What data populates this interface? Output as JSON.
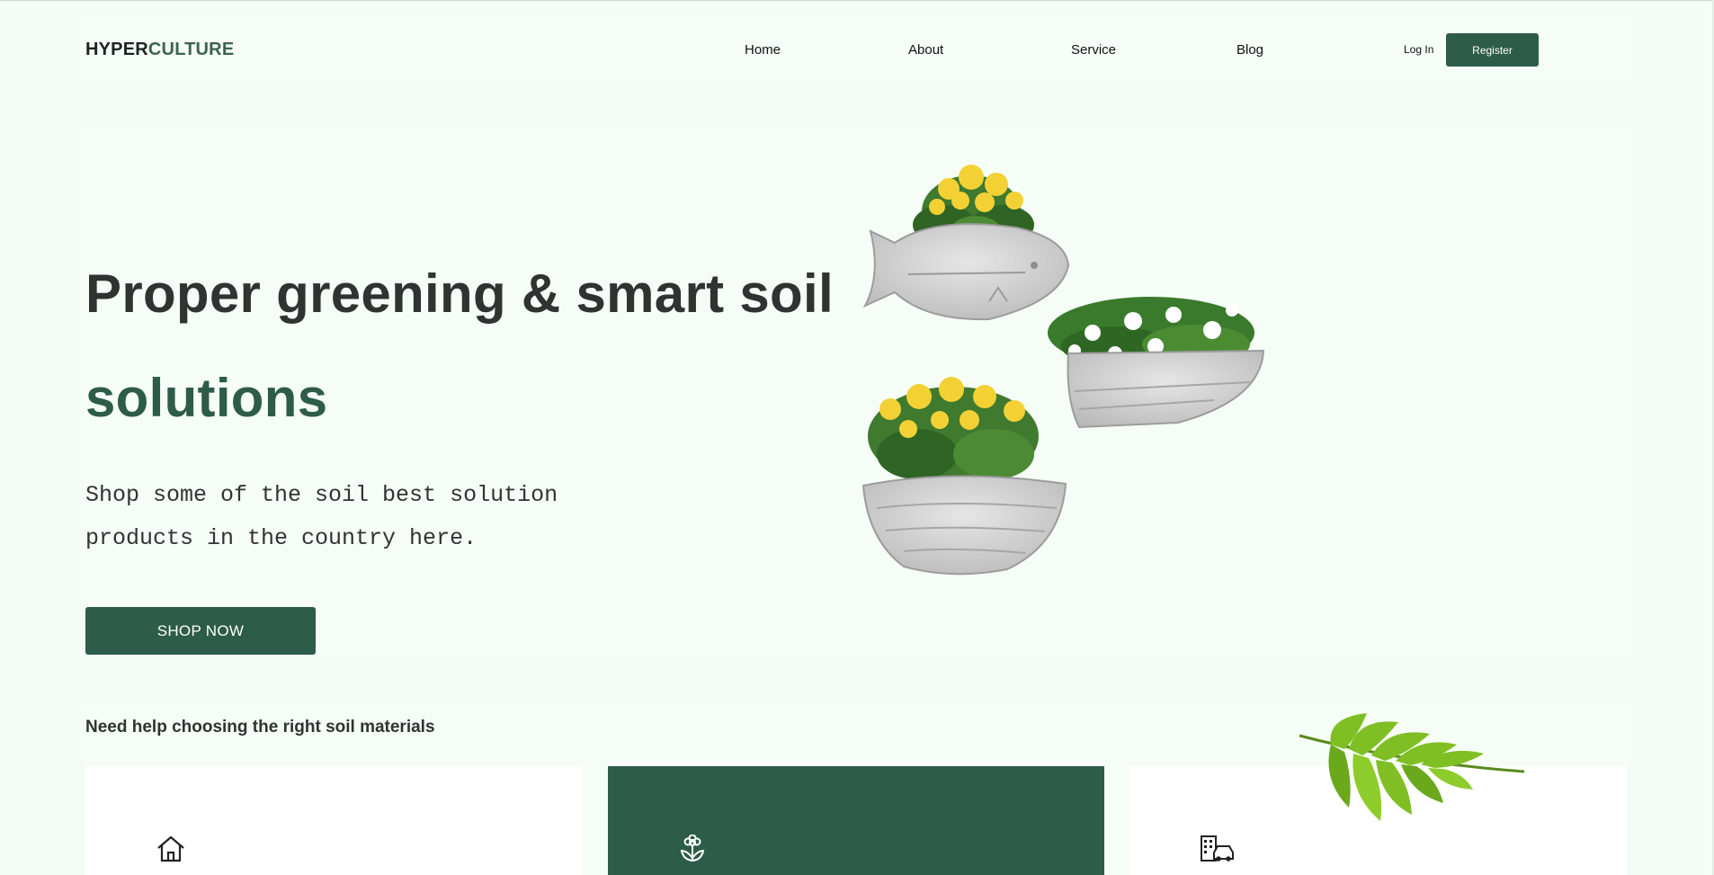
{
  "header": {
    "logo_part1": "HYPER",
    "logo_part2": "CULTURE",
    "nav": [
      {
        "label": "Home"
      },
      {
        "label": "About"
      },
      {
        "label": "Service"
      },
      {
        "label": "Blog"
      }
    ],
    "login_label": "Log In",
    "register_label": "Register"
  },
  "hero": {
    "title_line1": "Proper greening & smart soil",
    "title_line2": "solutions",
    "subtitle": "Shop some of the soil best solution products in the country here.",
    "cta_label": "SHOP NOW"
  },
  "help": {
    "title": "Need help choosing the right soil materials",
    "cards": [
      {
        "icon": "house-icon"
      },
      {
        "icon": "flower-icon"
      },
      {
        "icon": "building-car-icon"
      }
    ]
  },
  "colors": {
    "page_bg": "#f4fcf5",
    "brand_green": "#2d5c48",
    "text_dark": "#2f3331"
  }
}
